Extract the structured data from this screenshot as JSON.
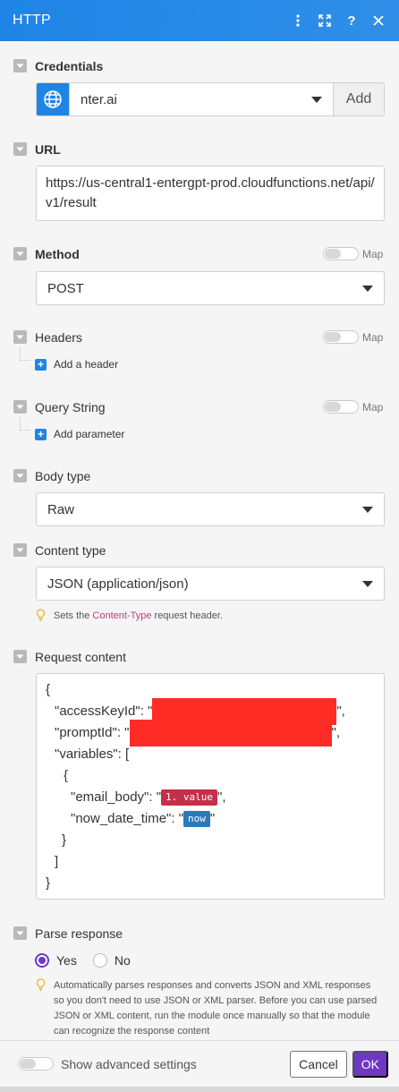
{
  "header": {
    "title": "HTTP"
  },
  "credentials": {
    "label": "Credentials",
    "value": "nter.ai",
    "add_label": "Add"
  },
  "url": {
    "label": "URL",
    "value": "https://us-central1-entergpt-prod.cloudfunctions.net/api/v1/result"
  },
  "map_label": "Map",
  "method": {
    "label": "Method",
    "value": "POST"
  },
  "headers": {
    "label": "Headers",
    "add_label": "Add a header"
  },
  "query_string": {
    "label": "Query String",
    "add_label": "Add parameter"
  },
  "body_type": {
    "label": "Body type",
    "value": "Raw"
  },
  "content_type": {
    "label": "Content type",
    "value": "JSON (application/json)",
    "hint_prefix": "Sets the",
    "hint_code": "Content-Type",
    "hint_suffix": "request header."
  },
  "request_content": {
    "label": "Request content",
    "l1": "{",
    "l2": "\"accessKeyId\": \"",
    "l2_end": "\",",
    "l3": "\"promptId\": \"",
    "l3_end": "\",",
    "l4": "\"variables\": [",
    "l5": "{",
    "l6": "\"email_body\": \"",
    "l6_pill": "1. value",
    "l6_end": "\",",
    "l7": "\"now_date_time\": \"",
    "l7_pill": "now",
    "l7_end": "\"",
    "l8": "}",
    "l9": "]",
    "l10": "}"
  },
  "parse_response": {
    "label": "Parse response",
    "yes": "Yes",
    "no": "No",
    "hint": "Automatically parses responses and converts JSON and XML responses so you don't need to use JSON or XML parser. Before you can use parsed JSON or XML content, run the module once manually so that the module can recognize the response content"
  },
  "footer": {
    "advanced_label": "Show advanced settings",
    "cancel_label": "Cancel",
    "ok_label": "OK"
  },
  "colors": {
    "accent": "#1e84e6",
    "primary_button": "#6e37c4",
    "redaction": "#ff2b25"
  }
}
